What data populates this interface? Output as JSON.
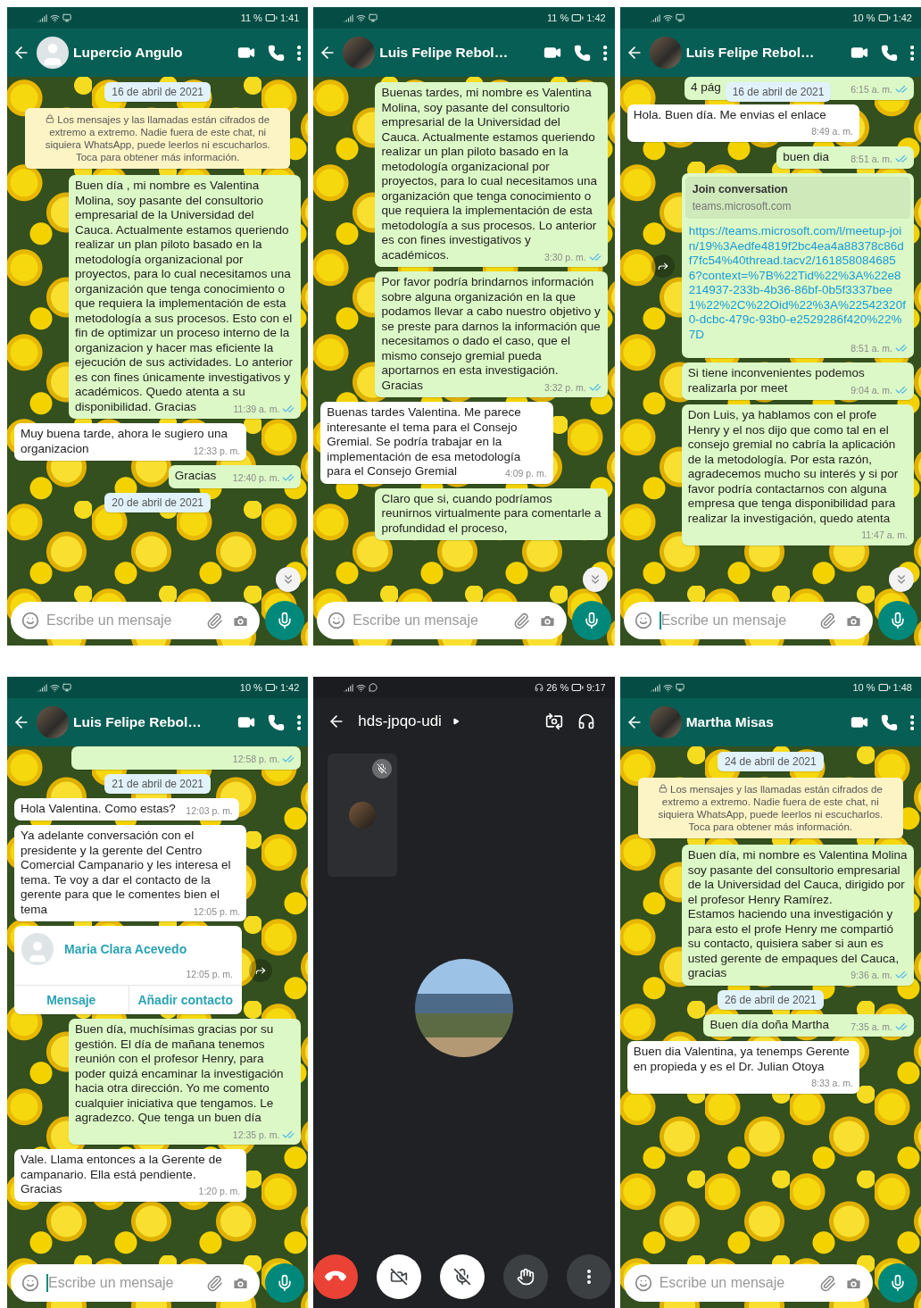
{
  "screens": [
    {
      "kind": "chat",
      "status": {
        "battery": "11 %",
        "time": "1:41"
      },
      "contact": {
        "name": "Lupercio Angulo",
        "photo": false
      },
      "items": [
        {
          "kind": "date",
          "text": "16 de abril de 2021"
        },
        {
          "kind": "notice",
          "text": "Los mensajes y las llamadas están cifrados de extremo a extremo. Nadie fuera de este chat, ni siquiera WhatsApp, puede leerlos ni escucharlos. Toca para obtener más información."
        },
        {
          "kind": "message",
          "outgoing": true,
          "text": "Buen día , mi nombre es Valentina Molina, soy pasante del consultorio empresarial de la Universidad del Cauca. Actualmente estamos queriendo realizar un plan piloto basado en la metodología organizacional por proyectos, para lo cual necesitamos una organización que tenga conocimiento o que requiera la implementación de esta metodología a sus procesos. Esto con el fin de optimizar un proceso interno de la organizacion y hacer mas eficiente la ejecución de sus actividades. Lo anterior es con fines únicamente investigativos y académicos. Quedo atenta a su disponibilidad. Gracias",
          "time": "11:39 a. m.",
          "read": true
        },
        {
          "kind": "message",
          "outgoing": false,
          "text": "Muy buena tarde, ahora le sugiero una organizacion",
          "time": "12:33 p. m."
        },
        {
          "kind": "message",
          "outgoing": true,
          "text": "Gracias",
          "time": "12:40 p. m.",
          "read": true
        },
        {
          "kind": "date",
          "text": "20 de abril de 2021"
        }
      ],
      "scroll_down": true,
      "composer": {
        "placeholder": "Escribe un mensaje",
        "focused": false
      }
    },
    {
      "kind": "chat",
      "status": {
        "battery": "11 %",
        "time": "1:42"
      },
      "contact": {
        "name": "Luis Felipe Rebol…",
        "photo": true
      },
      "items": [
        {
          "kind": "message",
          "outgoing": true,
          "text": "Buenas tardes, mi nombre es Valentina Molina, soy pasante del consultorio empresarial de la Universidad del Cauca. Actualmente estamos queriendo realizar un plan piloto basado en la metodología organizacional por proyectos, para lo cual necesitamos una organización que tenga conocimiento o que requiera la implementación de esta metodología a sus procesos. Lo anterior es con fines investigativos y académicos.",
          "time": "3:30 p. m.",
          "read": true
        },
        {
          "kind": "message",
          "outgoing": true,
          "text": "Por favor podría brindarnos información sobre alguna organización en la que podamos llevar a cabo nuestro objetivo y se preste para darnos la información que necesitamos o dado el caso, que el mismo consejo gremial pueda aportarnos en esta investigación. Gracias",
          "time": "3:32 p. m.",
          "read": true
        },
        {
          "kind": "message",
          "outgoing": false,
          "text": "Buenas tardes Valentina. Me parece interesante el tema para el Consejo Gremial. Se podría trabajar en la implementación de esa metodología para el Consejo Gremial",
          "time": "4:09 p. m."
        },
        {
          "kind": "message",
          "outgoing": true,
          "text": "Claro que si, cuando podríamos reunirnos virtualmente para comentarle a profundidad el proceso,"
        }
      ],
      "scroll_down": true,
      "composer": {
        "placeholder": "Escribe un mensaje",
        "focused": false
      }
    },
    {
      "kind": "chat",
      "status": {
        "battery": "10 %",
        "time": "1:42"
      },
      "contact": {
        "name": "Luis Felipe Rebol…",
        "photo": true
      },
      "items": [
        {
          "kind": "fragment",
          "outgoing": true,
          "text": "4 pág",
          "time": "6:15 a. m.",
          "read": true,
          "date": "16 de abril de 2021"
        },
        {
          "kind": "message",
          "outgoing": false,
          "text": "Hola. Buen día. Me envias el enlace",
          "time": "8:49 a. m."
        },
        {
          "kind": "message",
          "outgoing": true,
          "text": "buen dia",
          "time": "8:51 a. m.",
          "read": true
        },
        {
          "kind": "link",
          "outgoing": true,
          "title": "Join conversation",
          "domain": "teams.microsoft.com",
          "url": "https://teams.microsoft.com/l/meetup-join/19%3Aedfe4819f2bc4ea4a88378c86df7fc54%40thread.tacv2/1618580846856?context=%7B%22Tid%22%3A%22e8214937-233b-4b36-86bf-0b5f3337bee1%22%2C%22Oid%22%3A%22542320f0-dcbc-479c-93b0-e2529286f420%22%7D",
          "time": "8:51 a. m.",
          "read": true,
          "forward": true
        },
        {
          "kind": "message",
          "outgoing": true,
          "text": "Si tiene inconvenientes podemos realizarla por meet",
          "time": "9:04 a. m.",
          "read": true
        },
        {
          "kind": "message",
          "outgoing": true,
          "text": "Don Luis, ya hablamos con el profe Henry y el nos dijo que como tal en el consejo gremial no cabría la aplicación de la metodología. Por esta razón, agradecemos mucho su interés y si por favor podría contactarnos con alguna empresa que tenga disponibilidad para realizar la investigación, quedo atenta",
          "time": "11:47 a. m."
        }
      ],
      "scroll_down": true,
      "composer": {
        "placeholder": "Escribe un mensaje",
        "focused": true
      }
    },
    {
      "kind": "chat",
      "status": {
        "battery": "10 %",
        "time": "1:42"
      },
      "contact": {
        "name": "Luis Felipe Rebol…",
        "photo": true
      },
      "items": [
        {
          "kind": "fragment",
          "outgoing": true,
          "time": "12:58 p. m.",
          "read": true
        },
        {
          "kind": "date",
          "text": "21 de abril de 2021"
        },
        {
          "kind": "message",
          "outgoing": false,
          "text": "Hola Valentina. Como estas?",
          "time": "12:03 p. m."
        },
        {
          "kind": "message",
          "outgoing": false,
          "text": "Ya adelante conversación con el presidente y la gerente del Centro Comercial Campanario y les interesa el tema. Te voy a dar el contacto de la gerente para que le comentes bien el tema",
          "time": "12:05 p. m."
        },
        {
          "kind": "contact",
          "outgoing": false,
          "name": "Maria Clara Acevedo",
          "time": "12:05 p. m.",
          "actions": [
            "Mensaje",
            "Añadir contacto"
          ],
          "forward": true
        },
        {
          "kind": "message",
          "outgoing": true,
          "text": "Buen día, muchísimas gracias por su gestión. El día de mañana tenemos reunión con el profesor Henry, para poder quizá encaminar la investigación hacia otra dirección. Yo me comento cualquier iniciativa que tengamos. Le agradezco. Que tenga un buen día",
          "time": "12:35 p. m.",
          "read": true
        },
        {
          "kind": "message",
          "outgoing": false,
          "text": "Vale. Llama entonces a la Gerente de campanario. Ella está pendiente. Gracias",
          "time": "1:20 p. m."
        }
      ],
      "scroll_down": false,
      "composer": {
        "placeholder": "Escribe un mensaje",
        "focused": true
      }
    },
    {
      "kind": "meet",
      "status": {
        "battery": "26 %",
        "time": "9:17"
      },
      "title": "hds-jpqo-udi",
      "self_muted": true,
      "controls": [
        {
          "kind": "hangup"
        },
        {
          "kind": "camera",
          "on": false
        },
        {
          "kind": "mic",
          "on": false
        },
        {
          "kind": "hand"
        },
        {
          "kind": "more"
        }
      ]
    },
    {
      "kind": "chat",
      "status": {
        "battery": "10 %",
        "time": "1:48"
      },
      "contact": {
        "name": "Martha Misas",
        "photo": true
      },
      "items": [
        {
          "kind": "date",
          "text": "24 de abril de 2021"
        },
        {
          "kind": "notice",
          "text": "Los mensajes y las llamadas están cifrados de extremo a extremo. Nadie fuera de este chat, ni siquiera WhatsApp, puede leerlos ni escucharlos. Toca para obtener más información."
        },
        {
          "kind": "message",
          "outgoing": true,
          "text": "Buen día, mi nombre es Valentina Molina soy pasante del consultorio empresarial de la Universidad del Cauca, dirigido por el profesor Henry Ramírez.\nEstamos haciendo una investigación y para esto el profe Henry me compartió su contacto, quisiera saber si aun es usted gerente de empaques del Cauca, gracias",
          "time": "9:36 a. m.",
          "read": true
        },
        {
          "kind": "date",
          "text": "26 de abril de 2021"
        },
        {
          "kind": "message",
          "outgoing": true,
          "text": "Buen día doña Martha",
          "time": "7:35 a. m.",
          "read": true
        },
        {
          "kind": "message",
          "outgoing": false,
          "text": "Buen dia Valentina, ya tenemps Gerente en propieda y es el Dr. Julian Otoya",
          "time": "8:33 a. m."
        }
      ],
      "scroll_down": false,
      "composer": {
        "placeholder": "Escribe un mensaje",
        "focused": false
      }
    }
  ]
}
